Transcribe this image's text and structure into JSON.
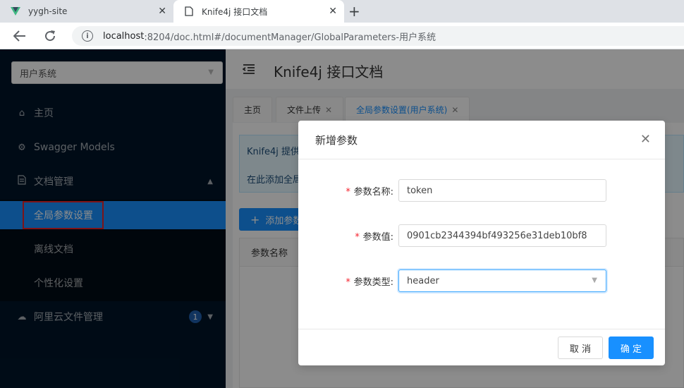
{
  "browser": {
    "tabs": [
      {
        "title": "yygh-site",
        "icon": "vue-logo-icon"
      },
      {
        "title": "Knife4j 接口文档",
        "icon": "page-icon"
      }
    ],
    "url_host": "localhost",
    "url_rest": ":8204/doc.html#/documentManager/GlobalParameters-用户系统"
  },
  "sidebar": {
    "space_select": "用户系统",
    "items": [
      {
        "label": "主页",
        "icon": "home-icon"
      },
      {
        "label": "Swagger Models",
        "icon": "settings-icon"
      },
      {
        "label": "文档管理",
        "icon": "document-icon"
      },
      {
        "label": "全局参数设置"
      },
      {
        "label": "离线文档"
      },
      {
        "label": "个性化设置"
      },
      {
        "label": "阿里云文件管理",
        "icon": "cloud-icon",
        "badge": "1"
      }
    ]
  },
  "header": {
    "title": "Knife4j 接口文档"
  },
  "page_tabs": [
    "主页",
    "文件上传",
    "全局参数设置(用户系统)"
  ],
  "content": {
    "alert_line1": "Knife4j 提供",
    "alert_line2": "在此添加全局",
    "add_button": "添加参数",
    "table_header": "参数名称"
  },
  "modal": {
    "title": "新增参数",
    "fields": [
      {
        "label": "参数名称:",
        "value": "token"
      },
      {
        "label": "参数值:",
        "value": "0901cb2344394bf493256e31deb10bf8"
      },
      {
        "label": "参数类型:",
        "value": "header"
      }
    ],
    "cancel": "取 消",
    "ok": "确 定"
  },
  "colors": {
    "primary": "#1890ff",
    "sidebar": "#001529",
    "highlight": "#e8262b"
  }
}
